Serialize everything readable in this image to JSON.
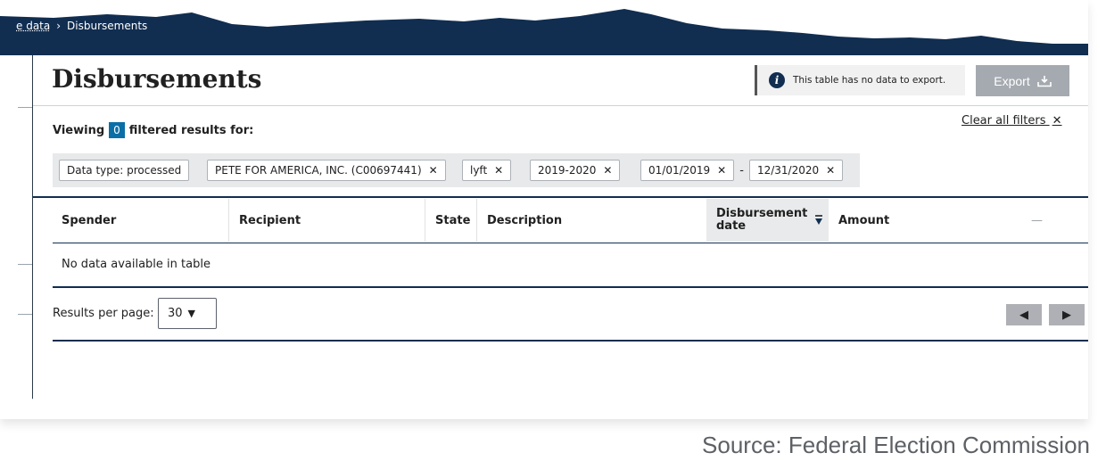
{
  "breadcrumb": {
    "parent": "e data",
    "separator": "›",
    "current": "Disbursements"
  },
  "page": {
    "title": "Disbursements",
    "export_notice": "This table has no data to export.",
    "export_label": "Export"
  },
  "filters": {
    "viewing_prefix": "Viewing",
    "count": "0",
    "viewing_suffix": "filtered results for:",
    "clear_all": "Clear all filters",
    "clear_icon": "✕",
    "tags": [
      {
        "label": "Data type: processed",
        "removable": false
      },
      {
        "label": "PETE FOR AMERICA, INC. (C00697441)",
        "removable": true
      },
      {
        "label": "lyft",
        "removable": true
      },
      {
        "label": "2019-2020",
        "removable": true
      },
      {
        "label": "01/01/2019",
        "removable": true
      },
      {
        "label": "12/31/2020",
        "removable": true
      }
    ],
    "date_range_separator": "-",
    "remove_icon": "✕"
  },
  "table": {
    "columns": [
      "Spender",
      "Recipient",
      "State",
      "Description",
      "Disbursement date",
      "Amount",
      "—"
    ],
    "sorted_column": "Disbursement date",
    "empty_message": "No data available in table"
  },
  "pagination": {
    "results_per_page_label": "Results per page:",
    "per_page_value": "30",
    "select_arrow": "▼",
    "prev_icon": "◀",
    "next_icon": "▶"
  },
  "footer": {
    "source": "Source: Federal Election Commission"
  },
  "colors": {
    "navy": "#112e51",
    "count_badge": "#0a6fa6",
    "chip_bg": "#e7e9ea",
    "export_disabled": "#a5aab0"
  }
}
